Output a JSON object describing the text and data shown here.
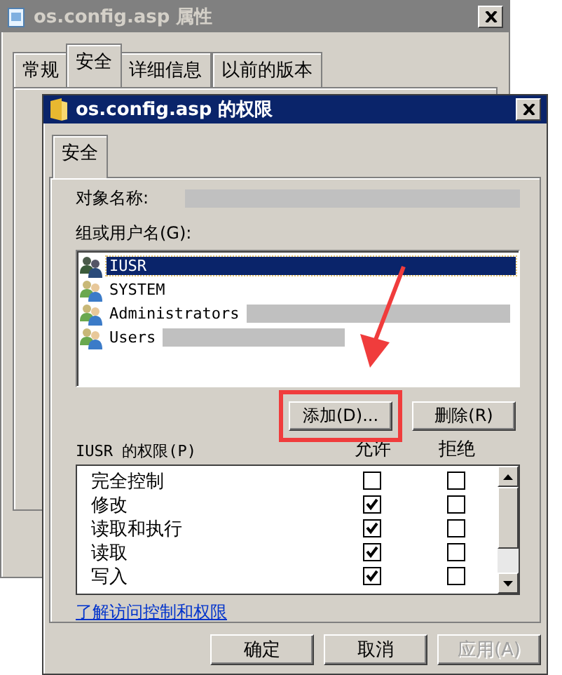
{
  "background_window": {
    "title": "os.config.asp 属性",
    "tabs": [
      {
        "label": "常规",
        "selected": false
      },
      {
        "label": "安全",
        "selected": true
      },
      {
        "label": "详细信息",
        "selected": false
      },
      {
        "label": "以前的版本",
        "selected": false
      }
    ]
  },
  "dialog": {
    "title": "os.config.asp 的权限",
    "tabs": [
      {
        "label": "安全",
        "selected": true
      }
    ],
    "object_name": {
      "label": "对象名称:",
      "redacted": true
    },
    "group_label": "组或用户名(G):",
    "principals": [
      {
        "name": "IUSR",
        "selected": true,
        "redacted": false
      },
      {
        "name": "SYSTEM",
        "selected": false,
        "redacted": false
      },
      {
        "name": "Administrators",
        "selected": false,
        "redacted": true
      },
      {
        "name": "Users",
        "selected": false,
        "redacted": true
      }
    ],
    "list_buttons": [
      {
        "label": "添加(D)...",
        "highlighted": true
      },
      {
        "label": "删除(R)",
        "highlighted": false
      }
    ],
    "permissions_label": "IUSR 的权限(P)",
    "columns": [
      "允许",
      "拒绝"
    ],
    "permissions": [
      {
        "name": "完全控制",
        "allow": false,
        "deny": false
      },
      {
        "name": "修改",
        "allow": true,
        "deny": false
      },
      {
        "name": "读取和执行",
        "allow": true,
        "deny": false
      },
      {
        "name": "读取",
        "allow": true,
        "deny": false
      },
      {
        "name": "写入",
        "allow": true,
        "deny": false
      }
    ],
    "link": "了解访问控制和权限",
    "buttons": [
      {
        "label": "确定",
        "disabled": false
      },
      {
        "label": "取消",
        "disabled": false
      },
      {
        "label": "应用(A)",
        "disabled": true
      }
    ]
  }
}
